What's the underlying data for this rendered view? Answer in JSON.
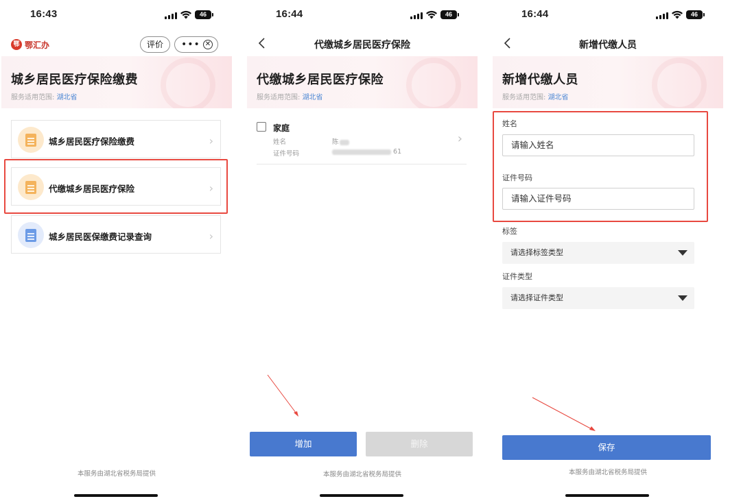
{
  "colors": {
    "primary": "#4879cf",
    "highlight": "#e8483f",
    "link": "#4a86d3",
    "brand": "#c8352a"
  },
  "screens": [
    {
      "time": "16:43",
      "battery": "46",
      "app": {
        "name": "鄂汇办",
        "logo_char": "鄂"
      },
      "header_buttons": {
        "rate": "评价",
        "more": "•••",
        "close": "✕"
      },
      "banner": {
        "title": "城乡居民医疗保险缴费",
        "scope_label": "服务适用范围:",
        "scope_value": "湖北省"
      },
      "menu": [
        {
          "label": "城乡居民医疗保险缴费",
          "icon": "document-icon"
        },
        {
          "label": "代缴城乡居民医疗保险",
          "icon": "document-icon",
          "highlighted": true
        },
        {
          "label": "城乡居民医保缴费记录查询",
          "icon": "record-icon"
        }
      ],
      "footer": "本服务由湖北省税务局提供"
    },
    {
      "time": "16:44",
      "battery": "46",
      "nav_title": "代缴城乡居民医疗保险",
      "banner": {
        "title": "代缴城乡居民医疗保险",
        "scope_label": "服务适用范围:",
        "scope_value": "湖北省"
      },
      "family": {
        "group": "家庭",
        "name_label": "姓名",
        "name_value": "陈",
        "id_label": "证件号码",
        "id_suffix": "61"
      },
      "buttons": {
        "add": "增加",
        "delete": "删除"
      },
      "footer": "本服务由湖北省税务局提供"
    },
    {
      "time": "16:44",
      "battery": "46",
      "nav_title": "新增代缴人员",
      "banner": {
        "title": "新增代缴人员",
        "scope_label": "服务适用范围:",
        "scope_value": "湖北省"
      },
      "form": {
        "name_label": "姓名",
        "name_placeholder": "请输入姓名",
        "id_label": "证件号码",
        "id_placeholder": "请输入证件号码",
        "tag_label": "标签",
        "tag_placeholder": "请选择标签类型",
        "idtype_label": "证件类型",
        "idtype_placeholder": "请选择证件类型"
      },
      "save": "保存",
      "footer": "本服务由湖北省税务局提供"
    }
  ]
}
